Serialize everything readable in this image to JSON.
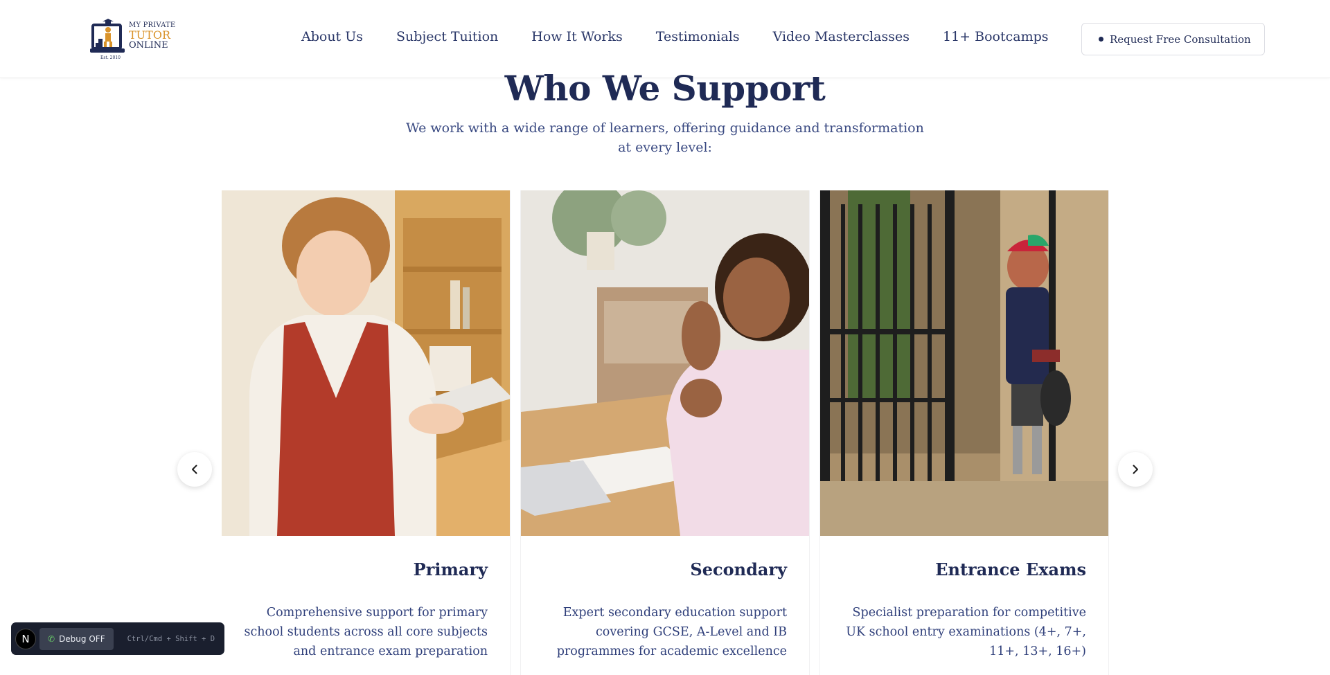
{
  "brand": {
    "line1": "MY PRIVATE",
    "line2": "TUTOR",
    "line3": "ONLINE",
    "est": "Est. 2010",
    "colors": {
      "navy": "#1f2a55",
      "gold": "#d9932b"
    }
  },
  "nav": {
    "items": [
      {
        "label": "About Us"
      },
      {
        "label": "Subject Tuition"
      },
      {
        "label": "How It Works"
      },
      {
        "label": "Testimonials"
      },
      {
        "label": "Video Masterclasses"
      },
      {
        "label": "11+ Bootcamps"
      }
    ],
    "cta_label": "Request Free Consultation"
  },
  "section": {
    "title": "Who We Support",
    "subtitle": "We work with a wide range of learners, offering guidance and transformation at every level:"
  },
  "cards": [
    {
      "title": "Primary",
      "description": "Comprehensive support for primary school students across all core subjects and entrance exam preparation",
      "image_subject": "young boy reading a tablet at a desk"
    },
    {
      "title": "Secondary",
      "description": "Expert secondary education support covering GCSE, A-Level and IB programmes for academic excellence",
      "image_subject": "smiling girl waving at a desk with notebook and keyboard"
    },
    {
      "title": "Entrance Exams",
      "description": "Specialist preparation for competitive UK school entry examinations (4+, 7+, 11+, 13+, 16+)",
      "image_subject": "schoolboy in uniform and cap outside iron gates"
    }
  ],
  "carousel": {
    "prev_icon": "chevron-left-icon",
    "next_icon": "chevron-right-icon"
  },
  "debug": {
    "logo_letter": "N",
    "button_label": "Debug OFF",
    "shortcut": "Ctrl/Cmd + Shift + D"
  }
}
